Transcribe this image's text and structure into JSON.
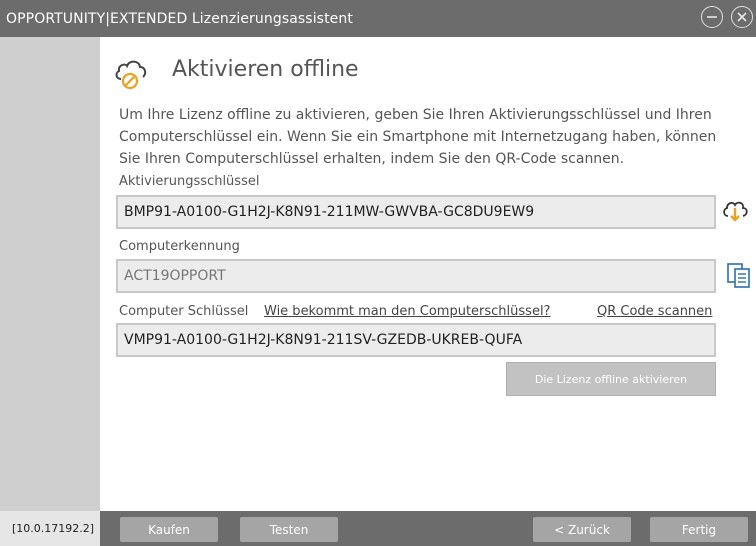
{
  "window": {
    "title": "OPPORTUNITY|EXTENDED Lizenzierungsassistent",
    "version": "[10.0.17192.2]"
  },
  "page": {
    "heading": "Aktivieren offline",
    "description": "Um Ihre Lizenz offline zu aktivieren, geben Sie Ihren Aktivierungsschlüssel und Ihren Computerschlüssel ein. Wenn Sie ein Smartphone mit Internetzugang haben, können Sie Ihren Computerschlüssel erhalten, indem Sie den QR-Code scannen."
  },
  "form": {
    "activation_key": {
      "label": "Aktivierungsschlüssel",
      "value": "BMP91-A0100-G1H2J-K8N91-211MW-GWVBA-GC8DU9EW9"
    },
    "computer_id": {
      "label": "Computerkennung",
      "value": "ACT19OPPORT"
    },
    "computer_key": {
      "label": "Computer Schlüssel",
      "help_link": "Wie bekommt man den Computerschlüssel?",
      "qr_link": "QR Code scannen",
      "value": "VMP91-A0100-G1H2J-K8N91-211SV-GZEDB-UKREB-QUFA"
    },
    "activate_button": "Die Lizenz offline aktivieren"
  },
  "footer": {
    "buy": "Kaufen",
    "test": "Testen",
    "back": "< Zurück",
    "finish": "Fertig"
  },
  "colors": {
    "accent": "#f0a020",
    "titlebar": "#6c6c6c",
    "sidebar": "#cfcfcf",
    "icon_blue": "#2a6fb0"
  },
  "icons": {
    "heading": "cloud-offline-icon",
    "download": "cloud-download-icon",
    "copy": "copy-icon",
    "minimize": "minimize-icon",
    "close": "close-icon"
  }
}
